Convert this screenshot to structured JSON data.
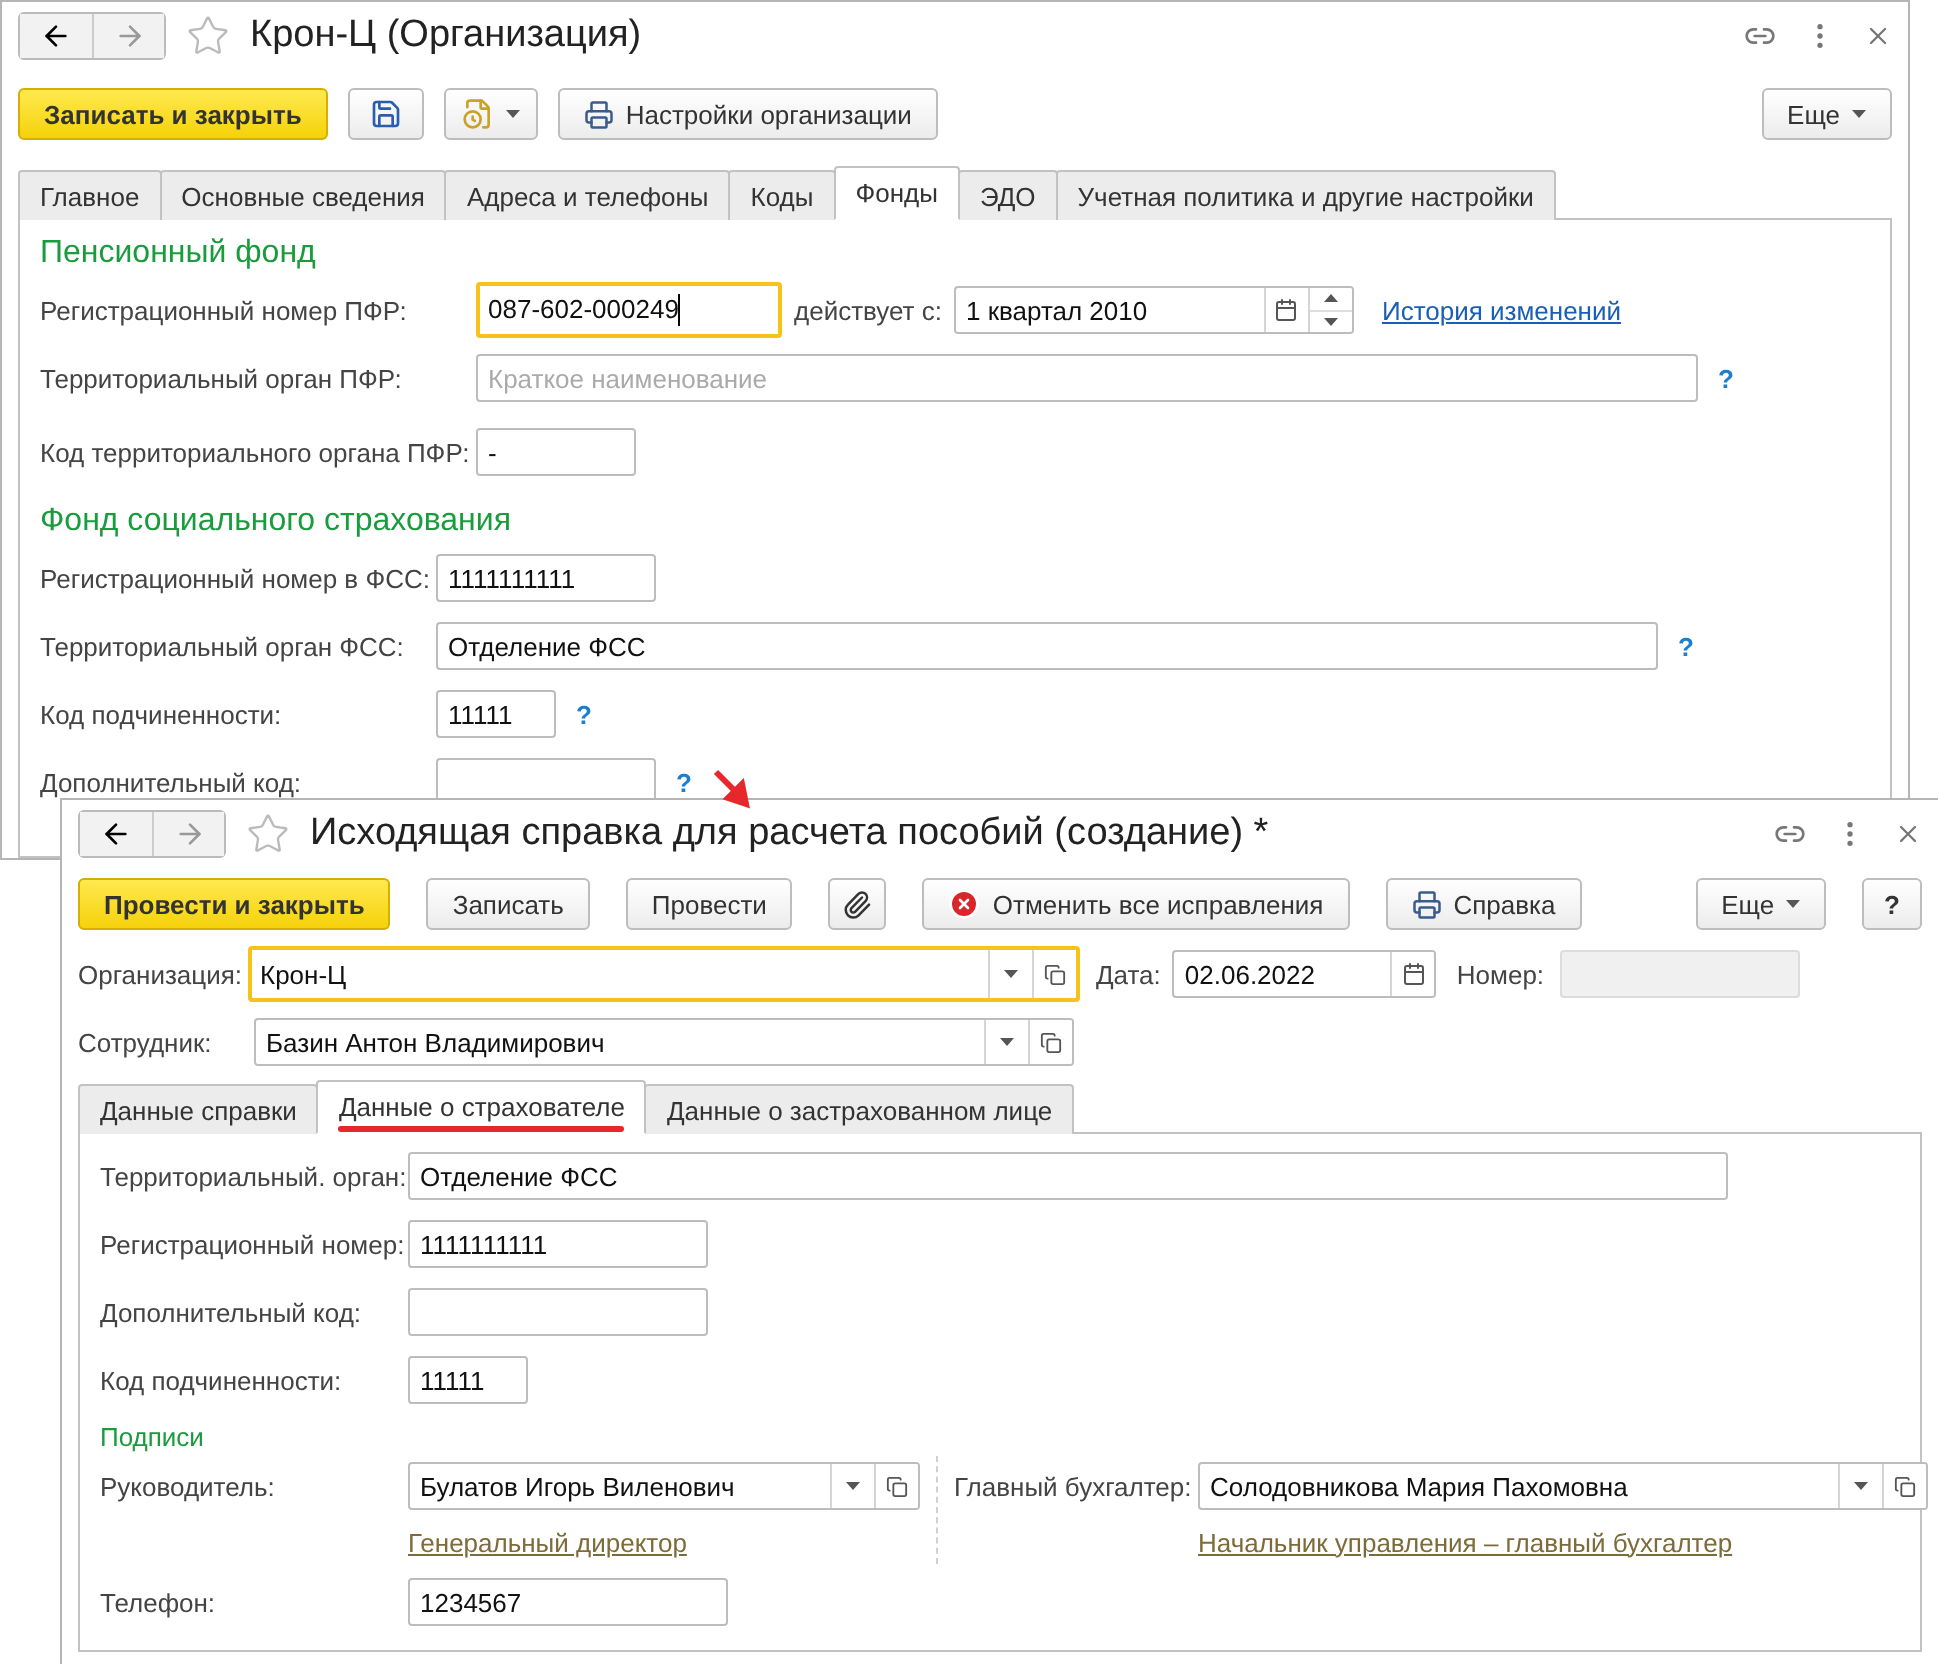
{
  "organization_window": {
    "title": "Крон-Ц (Организация)",
    "toolbar": [
      {
        "kind": "primary",
        "label": "Записать и закрыть"
      },
      {
        "kind": "save"
      },
      {
        "kind": "menu"
      },
      {
        "kind": "print",
        "label": "Настройки организации"
      }
    ],
    "more": "Еще",
    "tabs": [
      {
        "label": "Главное",
        "selected": false
      },
      {
        "label": "Основные сведения",
        "selected": false
      },
      {
        "label": "Адреса и телефоны",
        "selected": false
      },
      {
        "label": "Коды",
        "selected": false
      },
      {
        "label": "Фонды",
        "selected": true
      },
      {
        "label": "ЭДО",
        "selected": false
      },
      {
        "label": "Учетная политика и другие настройки",
        "selected": false
      }
    ],
    "sections": [
      {
        "title": "Пенсионный фонд",
        "rows": [
          {
            "kind": "registration",
            "label": "Регистрационный номер ПФР:",
            "value": "087-602-000249",
            "focused": true,
            "valid_from_label": "действует с:",
            "valid_from": "1 квартал 2010",
            "history_link": "История изменений"
          },
          {
            "kind": "text",
            "label": "Территориальный орган ПФР:",
            "placeholder": "Краткое наименование",
            "help": "?"
          },
          {
            "kind": "text",
            "label": "Код территориального органа ПФР:",
            "value": "-"
          }
        ]
      },
      {
        "title": "Фонд социального страхования",
        "rows": [
          {
            "kind": "text",
            "label": "Регистрационный номер в ФСС:",
            "value": "1111111111"
          },
          {
            "kind": "text",
            "label": "Территориальный орган ФСС:",
            "value": "Отделение ФСС",
            "help": "?"
          },
          {
            "kind": "text",
            "label": "Код подчиненности:",
            "value": "11111",
            "help": "?"
          },
          {
            "kind": "text",
            "label": "Дополнительный код:",
            "help": "?"
          }
        ]
      }
    ]
  },
  "document_window": {
    "title": "Исходящая справка для расчета пособий (создание) *",
    "toolbar": [
      {
        "kind": "primary",
        "label": "Провести и закрыть"
      },
      {
        "kind": "plain",
        "label": "Записать"
      },
      {
        "kind": "plain",
        "label": "Провести"
      },
      {
        "kind": "attach"
      },
      {
        "kind": "cancel",
        "label": "Отменить все исправления"
      },
      {
        "kind": "print",
        "label": "Справка"
      }
    ],
    "more": "Еще",
    "help": "?",
    "organization": {
      "label": "Организация:",
      "value": "Крон-Ц",
      "focused": true
    },
    "date": {
      "label": "Дата:",
      "value": "02.06.2022"
    },
    "number": {
      "label": "Номер:",
      "disabled": true
    },
    "employee": {
      "label": "Сотрудник:",
      "value": "Базин Антон Владимирович"
    },
    "tabs": [
      {
        "label": "Данные справки",
        "selected": false,
        "highlighted": false
      },
      {
        "label": "Данные о страхователе",
        "selected": true,
        "highlighted": true
      },
      {
        "label": "Данные о застрахованном лице",
        "selected": false,
        "highlighted": false
      }
    ],
    "fields": [
      {
        "label": "Территориальный. орган:",
        "value": "Отделение ФСС"
      },
      {
        "label": "Регистрационный номер:",
        "value": "1111111111"
      },
      {
        "label": "Дополнительный код:"
      },
      {
        "label": "Код подчиненности:",
        "value": "11111"
      }
    ],
    "signatures": {
      "title": "Подписи",
      "head": {
        "label": "Руководитель:",
        "value": "Булатов Игорь Виленович",
        "position": "Генеральный директор"
      },
      "chief_accountant": {
        "label": "Главный бухгалтер:",
        "value": "Солодовникова Мария Пахомовна",
        "position": "Начальник управления – главный бухгалтер"
      }
    },
    "phone": {
      "label": "Телефон:",
      "value": "1234567"
    }
  }
}
